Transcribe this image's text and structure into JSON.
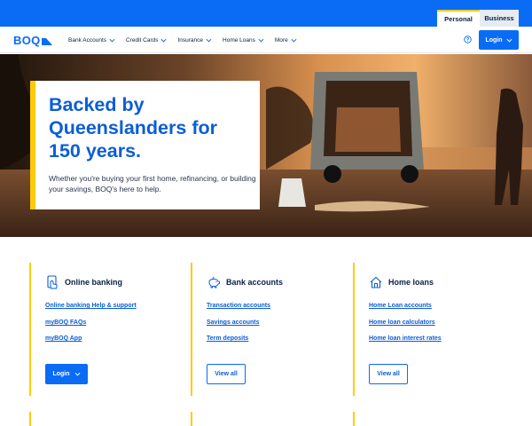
{
  "segment": {
    "personal": "Personal",
    "business": "Business"
  },
  "brand": {
    "logo_text": "BOQ"
  },
  "nav": {
    "items": [
      {
        "label": "Bank Accounts"
      },
      {
        "label": "Credit Cards"
      },
      {
        "label": "Insurance"
      },
      {
        "label": "Home Loans"
      },
      {
        "label": "More"
      }
    ],
    "login_label": "Login"
  },
  "hero": {
    "title": "Backed by Queenslanders for 150 years.",
    "text": "Whether you're buying your first home, refinancing, or building your savings, BOQ's here to help."
  },
  "tiles": [
    {
      "icon": "online-banking-icon",
      "title": "Online banking",
      "links": [
        "Online banking Help & support",
        "myBOQ FAQs",
        "myBOQ App"
      ],
      "button": "Login"
    },
    {
      "icon": "piggy-bank-icon",
      "title": "Bank accounts",
      "links": [
        "Transaction accounts",
        "Savings accounts",
        "Term deposits"
      ],
      "button": "View all"
    },
    {
      "icon": "house-icon",
      "title": "Home loans",
      "links": [
        "Home Loan accounts",
        "Home loan calculators",
        "Home loan interest rates"
      ],
      "button": "View all"
    }
  ],
  "colors": {
    "brand_blue": "#0a6cf5",
    "accent_yellow": "#ffcb05",
    "heading_blue": "#0a5ed7",
    "text_navy": "#0b1f44"
  }
}
